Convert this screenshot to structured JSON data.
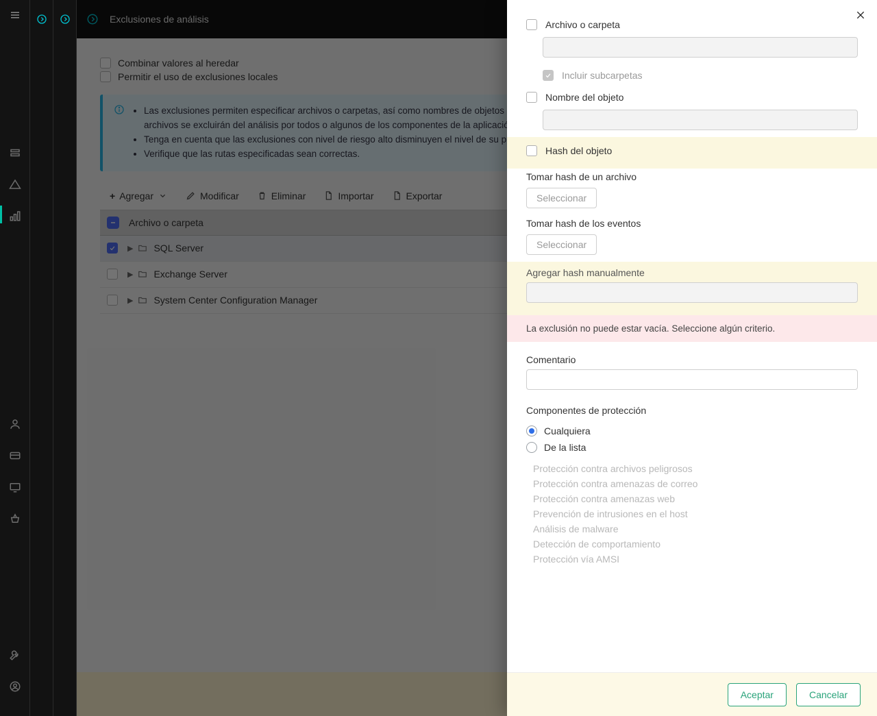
{
  "header": {
    "title": "Exclusiones de análisis"
  },
  "main": {
    "inherit_label": "Combinar valores al heredar",
    "local_label": "Permitir el uso de exclusiones locales",
    "info_bullets": [
      "Las exclusiones permiten especificar archivos o carpetas, así como nombres de objetos (de acuerdo con la clasificación de la Enciclopedia de virus de Kaspersky). Los archivos se excluirán del análisis por todos o algunos de los componentes de la aplicación.",
      "Tenga en cuenta que las exclusiones con nivel de riesgo alto disminuyen el nivel de su protección.",
      "Verifique que las rutas especificadas sean correctas."
    ],
    "toolbar": {
      "add": "Agregar",
      "edit": "Modificar",
      "delete": "Eliminar",
      "import": "Importar",
      "export": "Exportar"
    },
    "table_header": "Archivo o carpeta",
    "rows": [
      {
        "name": "SQL Server",
        "checked": true
      },
      {
        "name": "Exchange Server",
        "checked": false
      },
      {
        "name": "System Center Configuration Manager",
        "checked": false
      }
    ]
  },
  "panel": {
    "file_or_folder": "Archivo o carpeta",
    "include_subfolders": "Incluir subcarpetas",
    "object_name": "Nombre del objeto",
    "object_hash": "Hash del objeto",
    "take_hash_file": "Tomar hash de un archivo",
    "take_hash_events": "Tomar hash de los eventos",
    "select_btn": "Seleccionar",
    "add_hash_manual": "Agregar hash manualmente",
    "error_msg": "La exclusión no puede estar vacía. Seleccione algún criterio.",
    "comment_label": "Comentario",
    "components_label": "Componentes de protección",
    "radio_any": "Cualquiera",
    "radio_list": "De la lista",
    "components": [
      "Protección contra archivos peligrosos",
      "Protección contra amenazas de correo",
      "Protección contra amenazas web",
      "Prevención de intrusiones en el host",
      "Análisis de malware",
      "Detección de comportamiento",
      "Protección vía AMSI"
    ],
    "accept": "Aceptar",
    "cancel": "Cancelar"
  }
}
